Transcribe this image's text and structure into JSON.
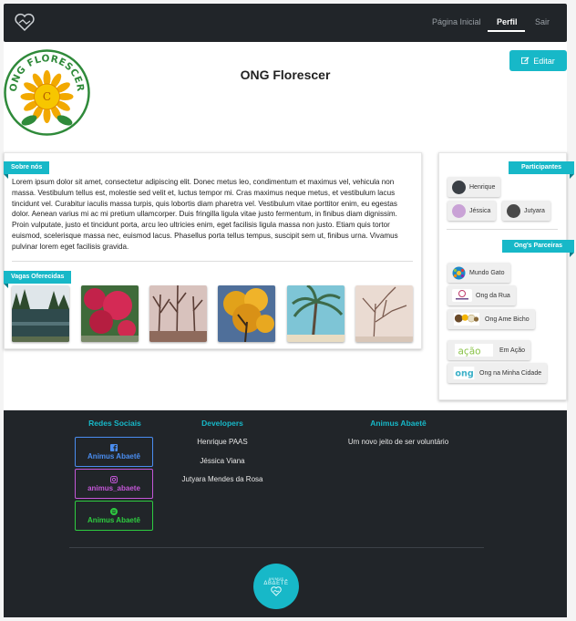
{
  "nav": {
    "logo_icon": "handshake-heart-icon",
    "links": [
      {
        "label": "Página Inicial"
      },
      {
        "label": "Perfil",
        "active": true
      },
      {
        "label": "Sair"
      }
    ]
  },
  "profile": {
    "name": "ONG Florescer",
    "avatar_text": "ONG FLORESCER",
    "edit_label": "Editar",
    "edit_icon": "edit-icon"
  },
  "about": {
    "heading": "Sobre nós",
    "text": "Lorem ipsum dolor sit amet, consectetur adipiscing elit. Donec metus leo, condimentum et maximus vel, vehicula non massa. Vestibulum tellus est, molestie sed velit et, luctus tempor mi. Cras maximus neque metus, et vestibulum lacus tincidunt vel. Curabitur iaculis massa turpis, quis lobortis diam pharetra vel. Vestibulum vitae porttitor enim, eu egestas dolor. Aenean varius mi ac mi pretium ullamcorper. Duis fringilla ligula vitae justo fermentum, in finibus diam dignissim. Proin vulputate, justo et tincidunt porta, arcu leo ultricies enim, eget facilisis ligula massa non justo. Etiam quis tortor euismod, scelerisque massa nec, euismod lacus. Phasellus porta tellus tempus, suscipit sem ut, finibus urna. Vivamus pulvinar lorem eget facilisis gravida."
  },
  "vagas": {
    "heading": "Vagas Oferecidas",
    "photos": [
      "lake-photo",
      "red-flowers-photo",
      "bare-trees-photo",
      "yellow-tree-photo",
      "palm-tree-photo",
      "winter-tree-photo"
    ]
  },
  "participants": {
    "heading": "Participantes",
    "items": [
      {
        "name": "Henrique",
        "color": "#3a3f45"
      },
      {
        "name": "Jéssica",
        "color": "#c9a2d6"
      },
      {
        "name": "Jutyara",
        "color": "#4a4a4a"
      }
    ]
  },
  "partners": {
    "heading": "Ong's Parceiras",
    "items": [
      {
        "name": "Mundo Gato"
      },
      {
        "name": "Ong da Rua"
      },
      {
        "name": "Ong Ame Bicho"
      },
      {
        "name": "Em Ação",
        "logo_text": "ação"
      },
      {
        "name": "Ong na Minha Cidade",
        "logo_text": "ong"
      }
    ]
  },
  "footer": {
    "social_heading": "Redes Sociais",
    "social": [
      {
        "label": "Animus Abaetê",
        "icon": "facebook-icon",
        "color": "#4a8df0"
      },
      {
        "label": "animus_abaete",
        "icon": "instagram-icon",
        "color": "#c457d8"
      },
      {
        "label": "Animus Abaetê",
        "icon": "spotify-icon",
        "color": "#2ecc40"
      }
    ],
    "dev_heading": "Developers",
    "devs": [
      "Henrique PAAS",
      "Jéssica Viana",
      "Jutyara Mendes da Rosa"
    ],
    "brand_heading": "Animus Abaetê",
    "tagline": "Um novo jeito de ser voluntário",
    "logo_top": "ANIMUS",
    "logo_brand": "ΔΒΔΕΤÊ",
    "logo_icon": "heart-hands-icon"
  },
  "colors": {
    "accent": "#17b8c8",
    "nav_bg": "#212529"
  }
}
